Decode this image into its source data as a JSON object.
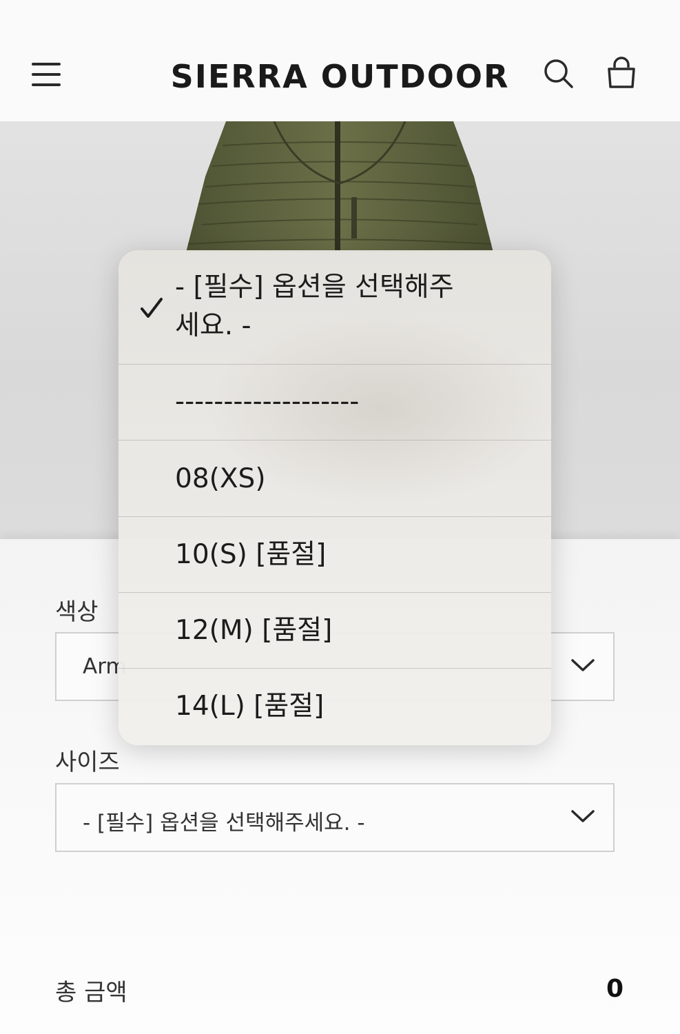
{
  "header": {
    "brand": "SIERRA OUTDOOR",
    "menu_icon": "hamburger-menu-icon",
    "search_icon": "search-icon",
    "bag_icon": "shopping-bag-icon"
  },
  "product": {
    "image_icon": "product-photo"
  },
  "options": {
    "color_label": "색상",
    "color_value": "Arm",
    "size_label": "사이즈",
    "size_value": "- [필수] 옵션을 선택해주세요. -"
  },
  "total": {
    "label": "총 금액",
    "value": "0"
  },
  "dropdown": {
    "options": [
      {
        "line1": "- [필수] 옵션을 선택해주",
        "line2": "세요. -",
        "selected": true
      },
      {
        "label": "-------------------"
      },
      {
        "label": "08(XS)"
      },
      {
        "label": "10(S) [품절]"
      },
      {
        "label": "12(M) [품절]"
      },
      {
        "label": "14(L) [품절]"
      }
    ]
  },
  "colors": {
    "background": "#ffffff",
    "header_bg": "#fafafa",
    "image_bg": "#dcdcdc",
    "border": "#cfcfcf",
    "text": "#222222"
  }
}
